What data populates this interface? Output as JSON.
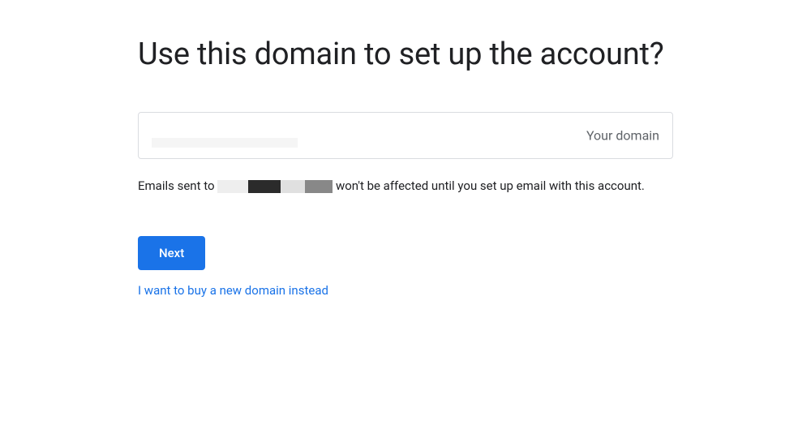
{
  "heading": "Use this domain to set up the account?",
  "domain_input": {
    "label": "Your domain",
    "value": ""
  },
  "helper_text": {
    "prefix": "Emails sent to ",
    "suffix": " won't be affected until you set up email with this account."
  },
  "actions": {
    "next_label": "Next",
    "buy_domain_link_label": "I want to buy a new domain instead"
  }
}
